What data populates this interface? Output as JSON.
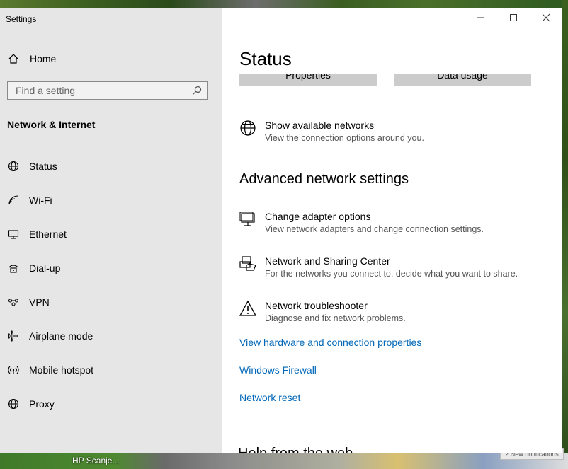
{
  "window": {
    "title": "Settings"
  },
  "desktop": {
    "taskbar_label": "HP Scanje...",
    "notification": "2 New notifications"
  },
  "sidebar": {
    "home_label": "Home",
    "search_placeholder": "Find a setting",
    "section_title": "Network & Internet",
    "items": [
      {
        "label": "Status",
        "icon": "globe-icon"
      },
      {
        "label": "Wi-Fi",
        "icon": "wifi-icon"
      },
      {
        "label": "Ethernet",
        "icon": "ethernet-icon"
      },
      {
        "label": "Dial-up",
        "icon": "dialup-icon"
      },
      {
        "label": "VPN",
        "icon": "vpn-icon"
      },
      {
        "label": "Airplane mode",
        "icon": "airplane-icon"
      },
      {
        "label": "Mobile hotspot",
        "icon": "hotspot-icon"
      },
      {
        "label": "Proxy",
        "icon": "globe-icon"
      }
    ]
  },
  "main": {
    "title": "Status",
    "buttons": [
      "Properties",
      "Data usage"
    ],
    "show_networks": {
      "title": "Show available networks",
      "desc": "View the connection options around you."
    },
    "advanced_heading": "Advanced network settings",
    "options": [
      {
        "title": "Change adapter options",
        "desc": "View network adapters and change connection settings."
      },
      {
        "title": "Network and Sharing Center",
        "desc": "For the networks you connect to, decide what you want to share."
      },
      {
        "title": "Network troubleshooter",
        "desc": "Diagnose and fix network problems."
      }
    ],
    "links": [
      "View hardware and connection properties",
      "Windows Firewall",
      "Network reset"
    ],
    "help_heading": "Help from the web"
  }
}
